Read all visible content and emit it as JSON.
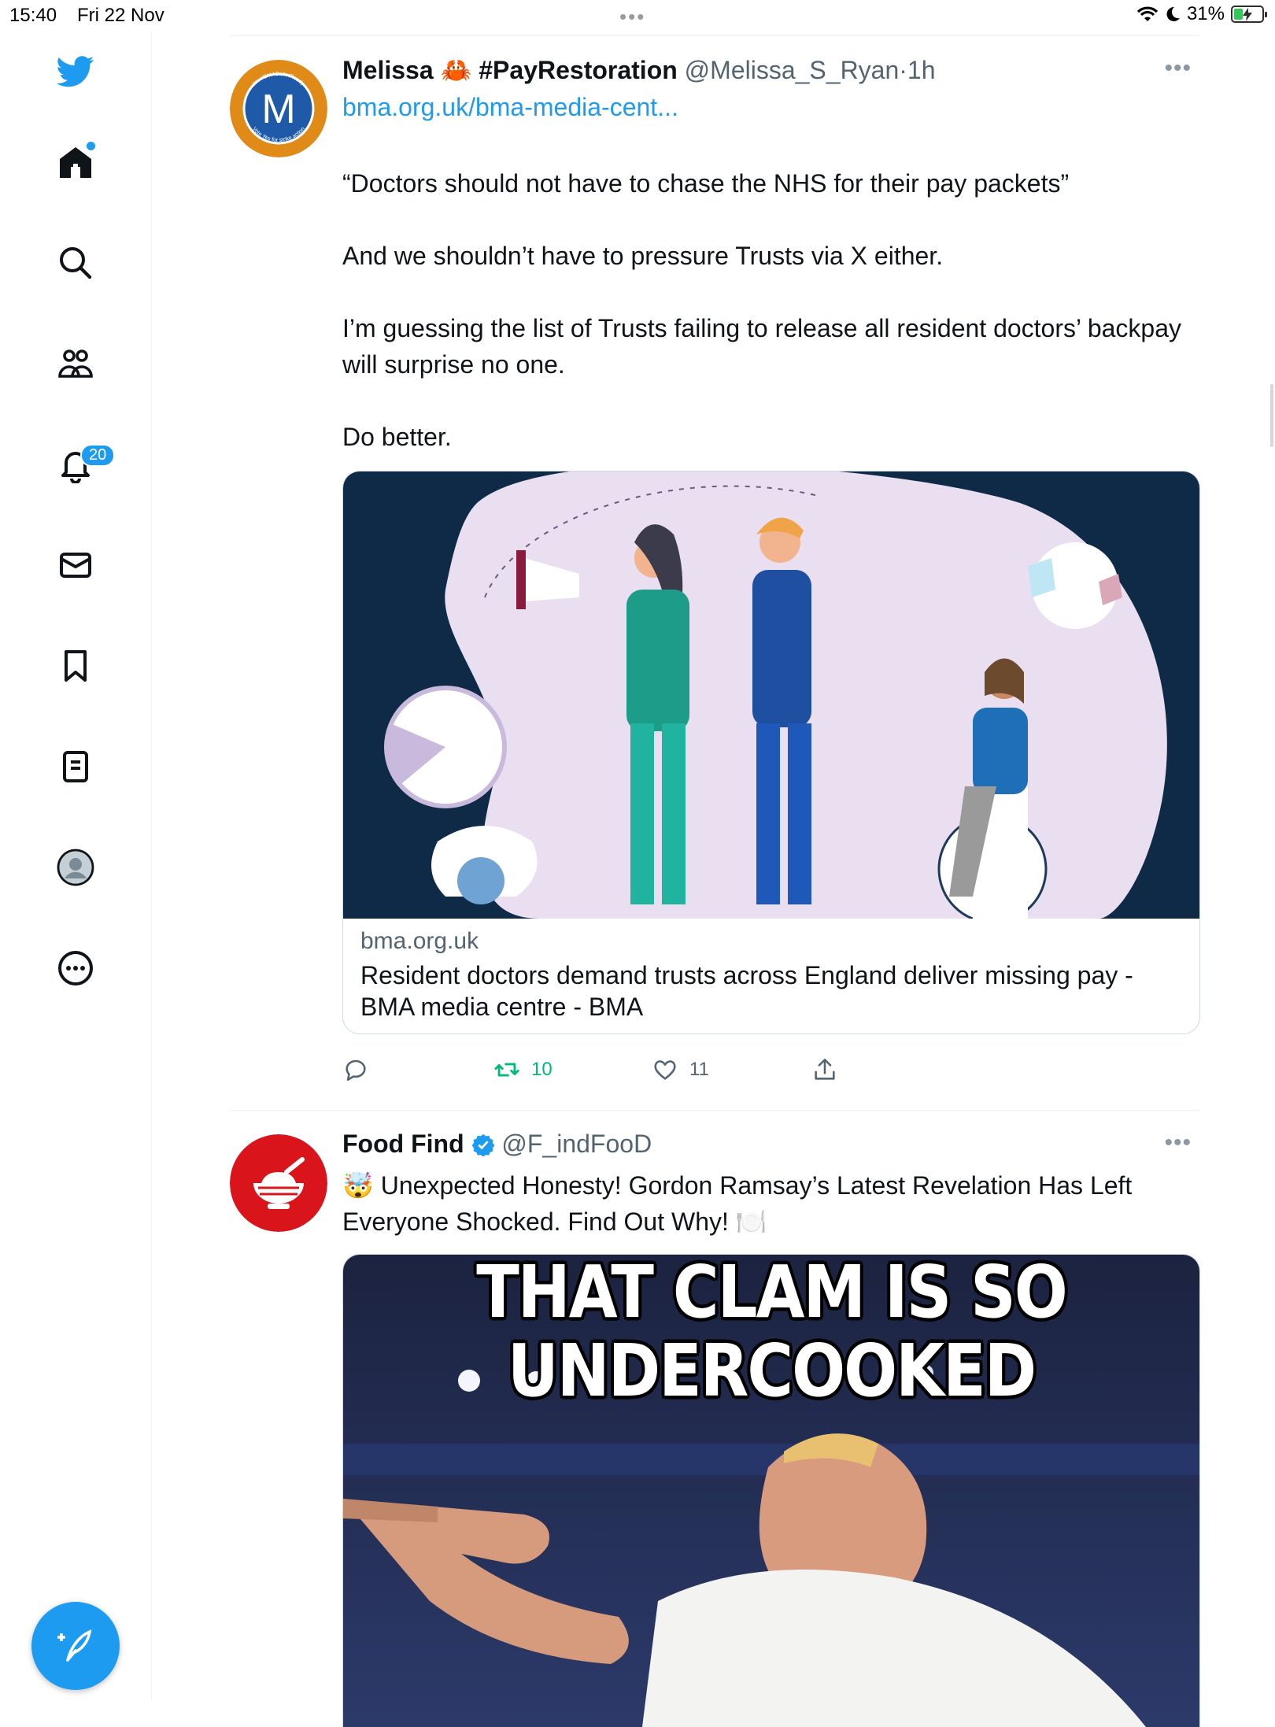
{
  "status_bar": {
    "time": "15:40",
    "date": "Fri 22 Nov",
    "battery": "31%",
    "battery_level": 0.31
  },
  "sidebar": {
    "items": [
      {
        "name": "twitter-logo-icon"
      },
      {
        "name": "home-icon"
      },
      {
        "name": "search-icon"
      },
      {
        "name": "communities-icon"
      },
      {
        "name": "notifications-icon",
        "badge": "20"
      },
      {
        "name": "messages-icon"
      },
      {
        "name": "bookmarks-icon"
      },
      {
        "name": "lists-icon"
      },
      {
        "name": "profile-avatar"
      },
      {
        "name": "more-icon"
      }
    ],
    "accent": "#1d9bf0"
  },
  "tweets": [
    {
      "name": "Melissa 🦀 #PayRestoration",
      "handle": "@Melissa_S_Ryan",
      "time": "1h",
      "avatar_letter": "M",
      "avatar_ring_top": "I'm #BMABallotReady",
      "avatar_ring_bottom": "Vote Yes for strike action",
      "link": "bma.org.uk/bma-media-cent...",
      "body": [
        "“Doctors should not have to chase the NHS for their pay packets”",
        "And we shouldn’t have to pressure Trusts via X either.",
        "I’m guessing the list of Trusts failing to release all resident doctors’ backpay will surprise no one.",
        "Do better."
      ],
      "card": {
        "domain": "bma.org.uk",
        "title": "Resident doctors demand trusts across England deliver missing pay - BMA media centre - BMA"
      },
      "retweets": "10",
      "likes": "11"
    },
    {
      "name": "Food Find",
      "handle": "@F_indFooD",
      "verified": true,
      "body": "🤯 Unexpected Honesty! Gordon Ramsay’s Latest Revelation Has Left Everyone Shocked. Find Out Why! 🍽️",
      "meme_line1": "THAT CLAM IS SO",
      "meme_line2": "UNDERCOOKED"
    }
  ],
  "colors": {
    "link": "#1d9bf0",
    "secondary_text": "#536471",
    "retweet": "#00ba7c",
    "divider": "#eff3f4"
  }
}
